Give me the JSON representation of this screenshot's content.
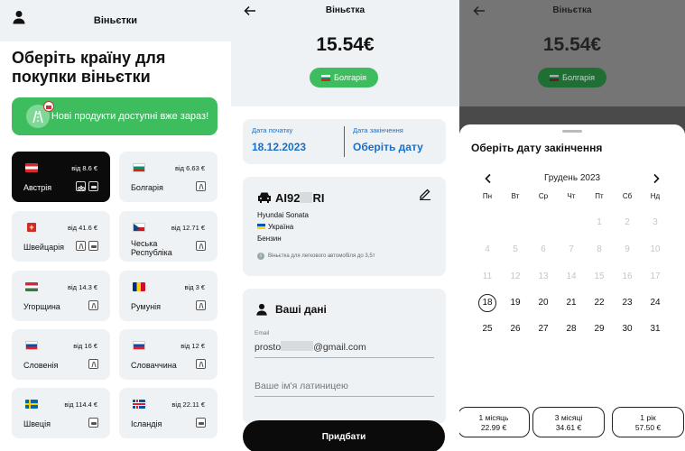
{
  "panel1": {
    "header_title": "Віньєтки",
    "heading": "Оберіть країну для покупки віньєтки",
    "promo_text": "Нові продукти доступні вже зараз!",
    "countries": [
      {
        "name": "Австрія",
        "price": "від 8.6 €"
      },
      {
        "name": "Болгарія",
        "price": "від 6.63 €"
      },
      {
        "name": "Швейцарія",
        "price": "від 41.6 €"
      },
      {
        "name": "Чеська Республіка",
        "price": "від 12.71 €"
      },
      {
        "name": "Угорщина",
        "price": "від 14.3 €"
      },
      {
        "name": "Румунія",
        "price": "від 3 €"
      },
      {
        "name": "Словенія",
        "price": "від 16 €"
      },
      {
        "name": "Словаччина",
        "price": "від 12 €"
      },
      {
        "name": "Швеція",
        "price": "від 114.4 €"
      },
      {
        "name": "Ісландія",
        "price": "від 22.11 €"
      }
    ]
  },
  "panel2": {
    "title": "Віньєтка",
    "amount": "15.54€",
    "country_pill": "Болгарія",
    "start_label": "Дата початку",
    "start_value": "18.12.2023",
    "end_label": "Дата закінчення",
    "end_value": "Оберіть дату",
    "plate_a": "AI92",
    "plate_b": "RI",
    "car_model": "Hyundai Sonata",
    "car_country": "Україна",
    "fuel": "Бензин",
    "note": "Віньєтка для легкового автомобіля до 3,5т",
    "form_title": "Ваші дані",
    "email_label": "Email",
    "email_a": "prosto",
    "email_b": "@gmail.com",
    "name_placeholder": "Ваше ім'я латиницею",
    "buy_label": "Придбати"
  },
  "panel3": {
    "title": "Віньєтка",
    "amount": "15.54€",
    "country_pill": "Болгарія",
    "sheet_title": "Оберіть дату закінчення",
    "month": "Грудень 2023",
    "weekdays": [
      "Пн",
      "Вт",
      "Ср",
      "Чт",
      "Пт",
      "Сб",
      "Нд"
    ],
    "row1": [
      "1",
      "2",
      "3"
    ],
    "row2": [
      "4",
      "5",
      "6",
      "7",
      "8",
      "9",
      "10"
    ],
    "row3": [
      "11",
      "12",
      "13",
      "14",
      "15",
      "16",
      "17"
    ],
    "row4": [
      "18",
      "19",
      "20",
      "21",
      "22",
      "23",
      "24"
    ],
    "row5": [
      "25",
      "26",
      "27",
      "28",
      "29",
      "30",
      "31"
    ],
    "options": [
      {
        "label": "1 місяць",
        "price": "22.99 €"
      },
      {
        "label": "3 місяці",
        "price": "34.61 €"
      },
      {
        "label": "1 рік",
        "price": "57.50 €"
      }
    ]
  },
  "colors": {
    "accent_green": "#3dbd5e",
    "accent_blue": "#1a6fc6",
    "dark": "#0b0b0b",
    "card_bg": "#eef2f5"
  }
}
